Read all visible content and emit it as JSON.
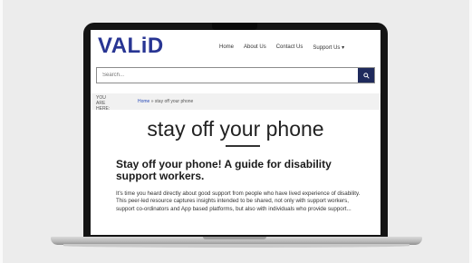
{
  "site": {
    "logo": "VALiD",
    "nav": [
      {
        "label": "Home"
      },
      {
        "label": "About Us"
      },
      {
        "label": "Contact Us"
      },
      {
        "label": "Support Us ▾"
      }
    ],
    "search": {
      "placeholder": "Search..."
    },
    "breadcrumb": {
      "you_are_here": "YOU ARE HERE:",
      "home": "Home",
      "separator": " » ",
      "current": "stay off your phone"
    },
    "page_title": "stay off your phone",
    "heading": "Stay off your phone! A guide for disability support workers.",
    "body": "It's time you heard directly about good support from people who have lived experience of disability. This peer-led resource captures insights intended to be shared, not only with support workers, support co-ordinators and App based platforms, but also with individuals who provide support..."
  },
  "colors": {
    "logo": "#283593",
    "search_button": "#1f2a5c",
    "breadcrumb_link": "#2a4bb8"
  },
  "icons": {
    "search_button": "search-icon"
  }
}
